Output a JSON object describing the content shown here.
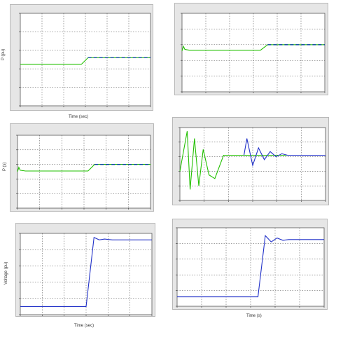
{
  "colors": {
    "trace_green": "#22c000",
    "trace_ref": "#0a3fa8",
    "trace_blue": "#2030c8",
    "axes_bg": "#ffffff",
    "panel": "#e6e6e6",
    "grid": "#444444"
  },
  "texts": {
    "ylabel_p1": "P (pu)",
    "ylabel_p3": "P (s)",
    "ylabel_p5": "Voltage (pu)",
    "xlabel_p1": "Time (sec)",
    "xlabel_p5": "Time (sec)",
    "xlabel_p6": "Time (s)"
  },
  "chart_data": [
    {
      "type": "line",
      "title": "",
      "ylabel": "P (pu)",
      "xlabel": "Time (sec)",
      "grid": true,
      "grid_cells": [
        6,
        5
      ],
      "xlim": [
        0,
        1
      ],
      "ylim": [
        0,
        1
      ],
      "series": [
        {
          "color": "green",
          "x": [
            0,
            0.47,
            0.52,
            1
          ],
          "y": [
            0.45,
            0.45,
            0.52,
            0.52
          ]
        },
        {
          "color": "blue-dashed",
          "x": [
            0.52,
            1
          ],
          "y": [
            0.52,
            0.52
          ]
        }
      ]
    },
    {
      "type": "line",
      "title": "",
      "grid": true,
      "grid_cells": [
        6,
        5
      ],
      "xlim": [
        0,
        1
      ],
      "ylim": [
        0,
        1
      ],
      "series": [
        {
          "color": "green",
          "x": [
            0,
            0.01,
            0.02,
            0.05,
            0.55,
            0.6,
            1
          ],
          "y": [
            0.52,
            0.58,
            0.54,
            0.53,
            0.53,
            0.6,
            0.6
          ]
        },
        {
          "color": "blue-dashed",
          "x": [
            0.6,
            1
          ],
          "y": [
            0.6,
            0.6
          ]
        }
      ]
    },
    {
      "type": "line",
      "title": "",
      "ylabel": "P (s)",
      "grid": true,
      "grid_cells": [
        6,
        5
      ],
      "xlim": [
        0,
        1
      ],
      "ylim": [
        0,
        1
      ],
      "series": [
        {
          "color": "green",
          "x": [
            0,
            0.01,
            0.02,
            0.06,
            0.53,
            0.58,
            1
          ],
          "y": [
            0.5,
            0.56,
            0.52,
            0.51,
            0.51,
            0.6,
            0.6
          ]
        },
        {
          "color": "blue-dashed",
          "x": [
            0.58,
            1
          ],
          "y": [
            0.6,
            0.6
          ]
        }
      ]
    },
    {
      "type": "line",
      "title": "",
      "grid": true,
      "grid_cells": [
        6,
        5
      ],
      "xlim": [
        0,
        1
      ],
      "ylim": [
        0,
        1
      ],
      "series": [
        {
          "color": "green-oscillation",
          "x": [
            0,
            0.05,
            0.07,
            0.1,
            0.13,
            0.16,
            0.2,
            0.24,
            0.3,
            1
          ],
          "y": [
            0.4,
            0.95,
            0.15,
            0.85,
            0.2,
            0.7,
            0.35,
            0.3,
            0.62,
            0.62
          ]
        },
        {
          "color": "blue-damped",
          "x": [
            0.44,
            0.46,
            0.5,
            0.54,
            0.58,
            0.62,
            0.66,
            0.7,
            0.74,
            1
          ],
          "y": [
            0.62,
            0.85,
            0.48,
            0.72,
            0.56,
            0.67,
            0.6,
            0.64,
            0.62,
            0.62
          ]
        }
      ]
    },
    {
      "type": "line",
      "title": "",
      "ylabel": "Voltage (pu)",
      "xlabel": "Time (sec)",
      "grid": true,
      "grid_cells": [
        6,
        5
      ],
      "xlim": [
        0,
        1
      ],
      "ylim": [
        0,
        1
      ],
      "series": [
        {
          "color": "blue",
          "x": [
            0,
            0.5,
            0.56,
            0.6,
            0.64,
            0.7,
            1
          ],
          "y": [
            0.1,
            0.1,
            0.95,
            0.92,
            0.93,
            0.92,
            0.92
          ]
        }
      ]
    },
    {
      "type": "line",
      "title": "",
      "xlabel": "Time (s)",
      "grid": true,
      "grid_cells": [
        6,
        5
      ],
      "xlim": [
        0,
        1
      ],
      "ylim": [
        0,
        1
      ],
      "series": [
        {
          "color": "blue",
          "x": [
            0,
            0.55,
            0.6,
            0.64,
            0.68,
            0.72,
            0.76,
            0.8,
            1
          ],
          "y": [
            0.12,
            0.12,
            0.9,
            0.82,
            0.87,
            0.84,
            0.85,
            0.85,
            0.85
          ]
        }
      ]
    }
  ]
}
